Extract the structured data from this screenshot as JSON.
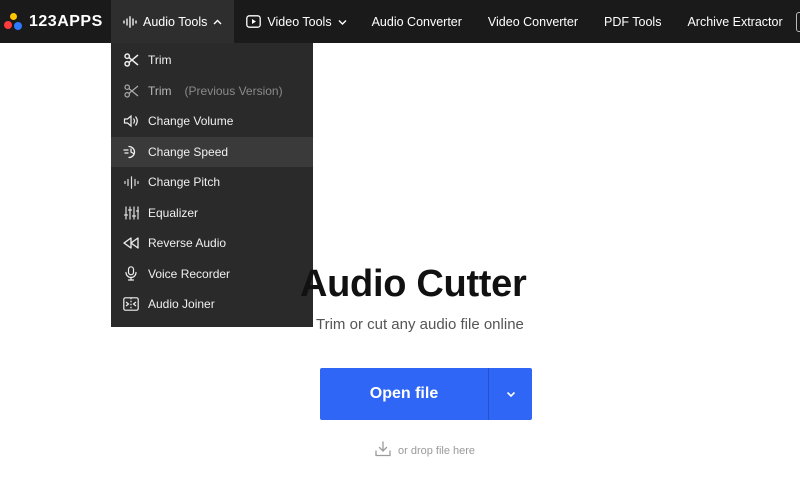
{
  "brand": {
    "logo_text": "123APPS"
  },
  "nav": {
    "audio_tools": "Audio Tools",
    "video_tools": "Video Tools",
    "audio_converter": "Audio Converter",
    "video_converter": "Video Converter",
    "pdf_tools": "PDF Tools",
    "archive_extractor": "Archive Extractor"
  },
  "dropdown": {
    "items": [
      {
        "label": "Trim",
        "icon": "scissors-icon"
      },
      {
        "label": "Trim",
        "suffix": "(Previous Version)",
        "icon": "scissors-outline-icon"
      },
      {
        "label": "Change Volume",
        "icon": "volume-icon"
      },
      {
        "label": "Change Speed",
        "icon": "speed-icon",
        "highlighted": true
      },
      {
        "label": "Change Pitch",
        "icon": "waveform-icon"
      },
      {
        "label": "Equalizer",
        "icon": "equalizer-icon"
      },
      {
        "label": "Reverse Audio",
        "icon": "rewind-icon"
      },
      {
        "label": "Voice Recorder",
        "icon": "microphone-icon"
      },
      {
        "label": "Audio Joiner",
        "icon": "join-icon"
      }
    ]
  },
  "main": {
    "title": "Audio Cutter",
    "subtitle": "Trim or cut any audio file online",
    "open_button": "Open file",
    "drop_hint": "or drop file here"
  },
  "colors": {
    "topbar": "#1a1a1a",
    "dropdown_bg": "#2a2a2a",
    "primary_button": "#2f66f6"
  }
}
